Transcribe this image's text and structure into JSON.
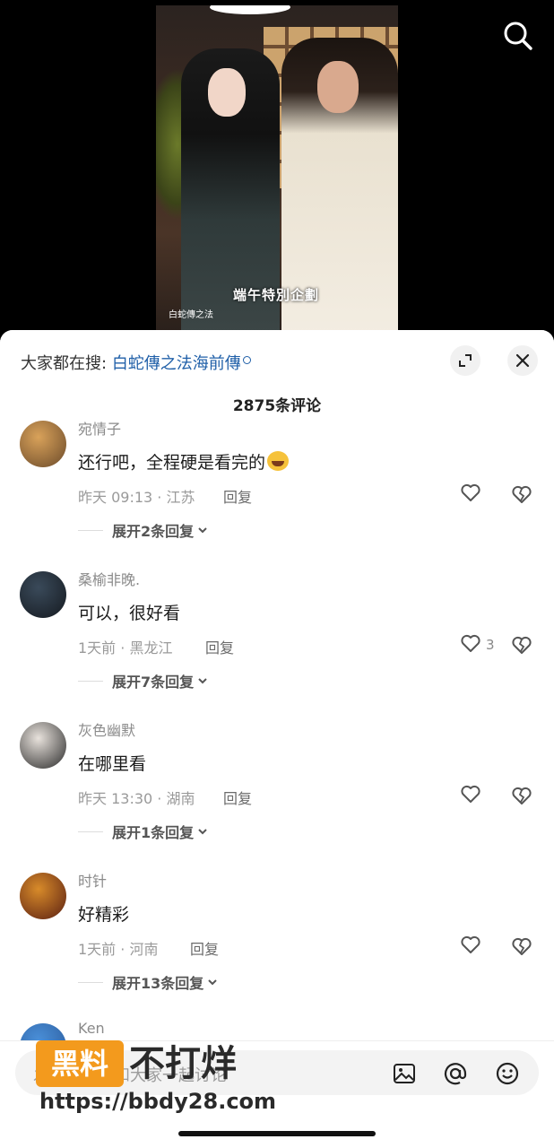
{
  "video": {
    "caption": "端午特別企劃",
    "corner_text": "白蛇傳之法"
  },
  "sheet": {
    "search_prefix": "大家都在搜:",
    "search_link": "白蛇傳之法海前傳",
    "comment_count_label": "2875条评论"
  },
  "comments": [
    {
      "username": "宛情子",
      "text": "还行吧，全程硬是看完的",
      "has_emoji": true,
      "time": "昨天 09:13",
      "location": "江苏",
      "reply_label": "回复",
      "likes": "",
      "expand_label": "展开2条回复",
      "avatar_colors": [
        "#d9a25a",
        "#6b4a2a"
      ]
    },
    {
      "username": "桑榆非晚.",
      "text": "可以，很好看",
      "has_emoji": false,
      "time": "1天前",
      "location": "黑龙江",
      "reply_label": "回复",
      "likes": "3",
      "expand_label": "展开7条回复",
      "avatar_colors": [
        "#3a4a5a",
        "#151a20"
      ]
    },
    {
      "username": "灰色幽默",
      "text": "在哪里看",
      "has_emoji": false,
      "time": "昨天 13:30",
      "location": "湖南",
      "reply_label": "回复",
      "likes": "",
      "expand_label": "展开1条回复",
      "avatar_colors": [
        "#e8e2dc",
        "#2a2a2a"
      ]
    },
    {
      "username": "时针",
      "text": "好精彩",
      "has_emoji": false,
      "time": "1天前",
      "location": "河南",
      "reply_label": "回复",
      "likes": "",
      "expand_label": "展开13条回复",
      "avatar_colors": [
        "#d88b2a",
        "#5a1f12"
      ]
    },
    {
      "username": "Ken",
      "text": "",
      "has_emoji": false,
      "time": "",
      "location": "",
      "reply_label": "",
      "likes": "",
      "expand_label": "",
      "avatar_colors": [
        "#4a8fd8",
        "#2a5a9a"
      ]
    }
  ],
  "input": {
    "placeholder": "发条评论，和大家一起讨论"
  },
  "watermark": {
    "badge": "黑料",
    "slogan": "不打烊",
    "url": "https://bbdy28.com"
  },
  "colors": {
    "link": "#1f5fa8",
    "watermark_orange": "#f39a1d"
  }
}
